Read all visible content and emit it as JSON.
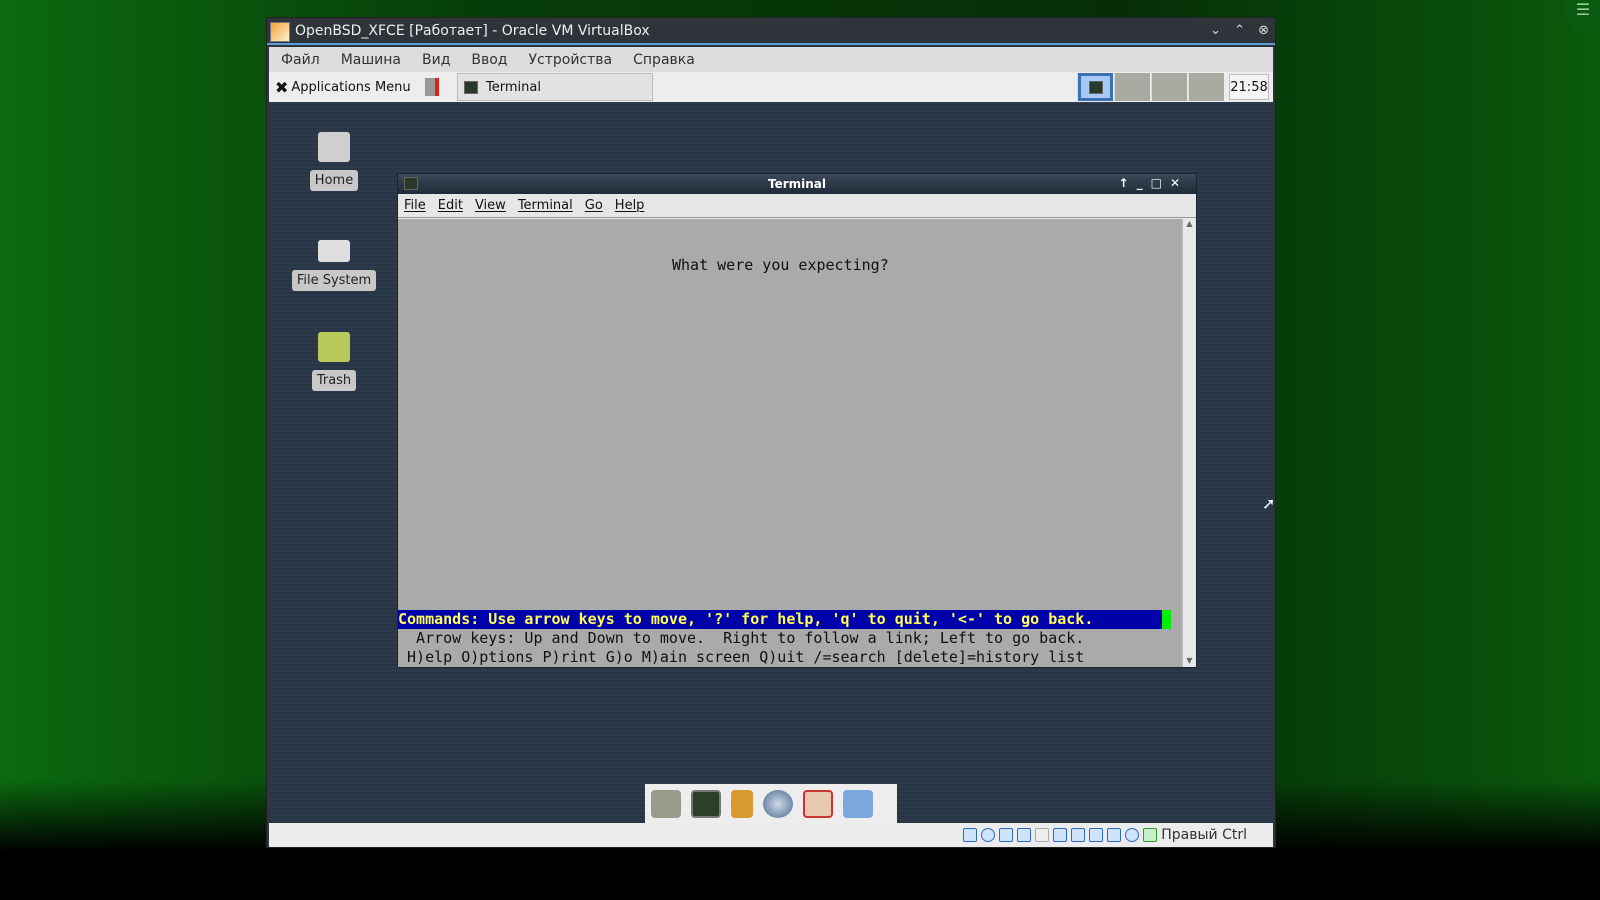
{
  "vbox": {
    "title": "OpenBSD_XFCE [Работает] - Oracle VM VirtualBox",
    "menu": [
      "Файл",
      "Машина",
      "Вид",
      "Ввод",
      "Устройства",
      "Справка"
    ],
    "host_key": "Правый Ctrl"
  },
  "panel": {
    "app_menu": "Applications Menu",
    "task": "Terminal",
    "clock": "21:58"
  },
  "desktop": {
    "icons": [
      "Home",
      "File System",
      "Trash"
    ]
  },
  "terminal": {
    "title": "Terminal",
    "menu": [
      "File",
      "Edit",
      "View",
      "Terminal",
      "Go",
      "Help"
    ],
    "lines": {
      "main": "What were you expecting?",
      "commands": "Commands: Use arrow keys to move, '?' for help, 'q' to quit, '<-' to go back.",
      "arrows": "  Arrow keys: Up and Down to move.  Right to follow a link; Left to go back.",
      "keys": " H)elp O)ptions P)rint G)o M)ain screen Q)uit /=search [delete]=history list"
    }
  },
  "colors": {
    "status_bg": "#0000aa",
    "status_fg": "#ffff55",
    "cursor": "#00ee00"
  }
}
